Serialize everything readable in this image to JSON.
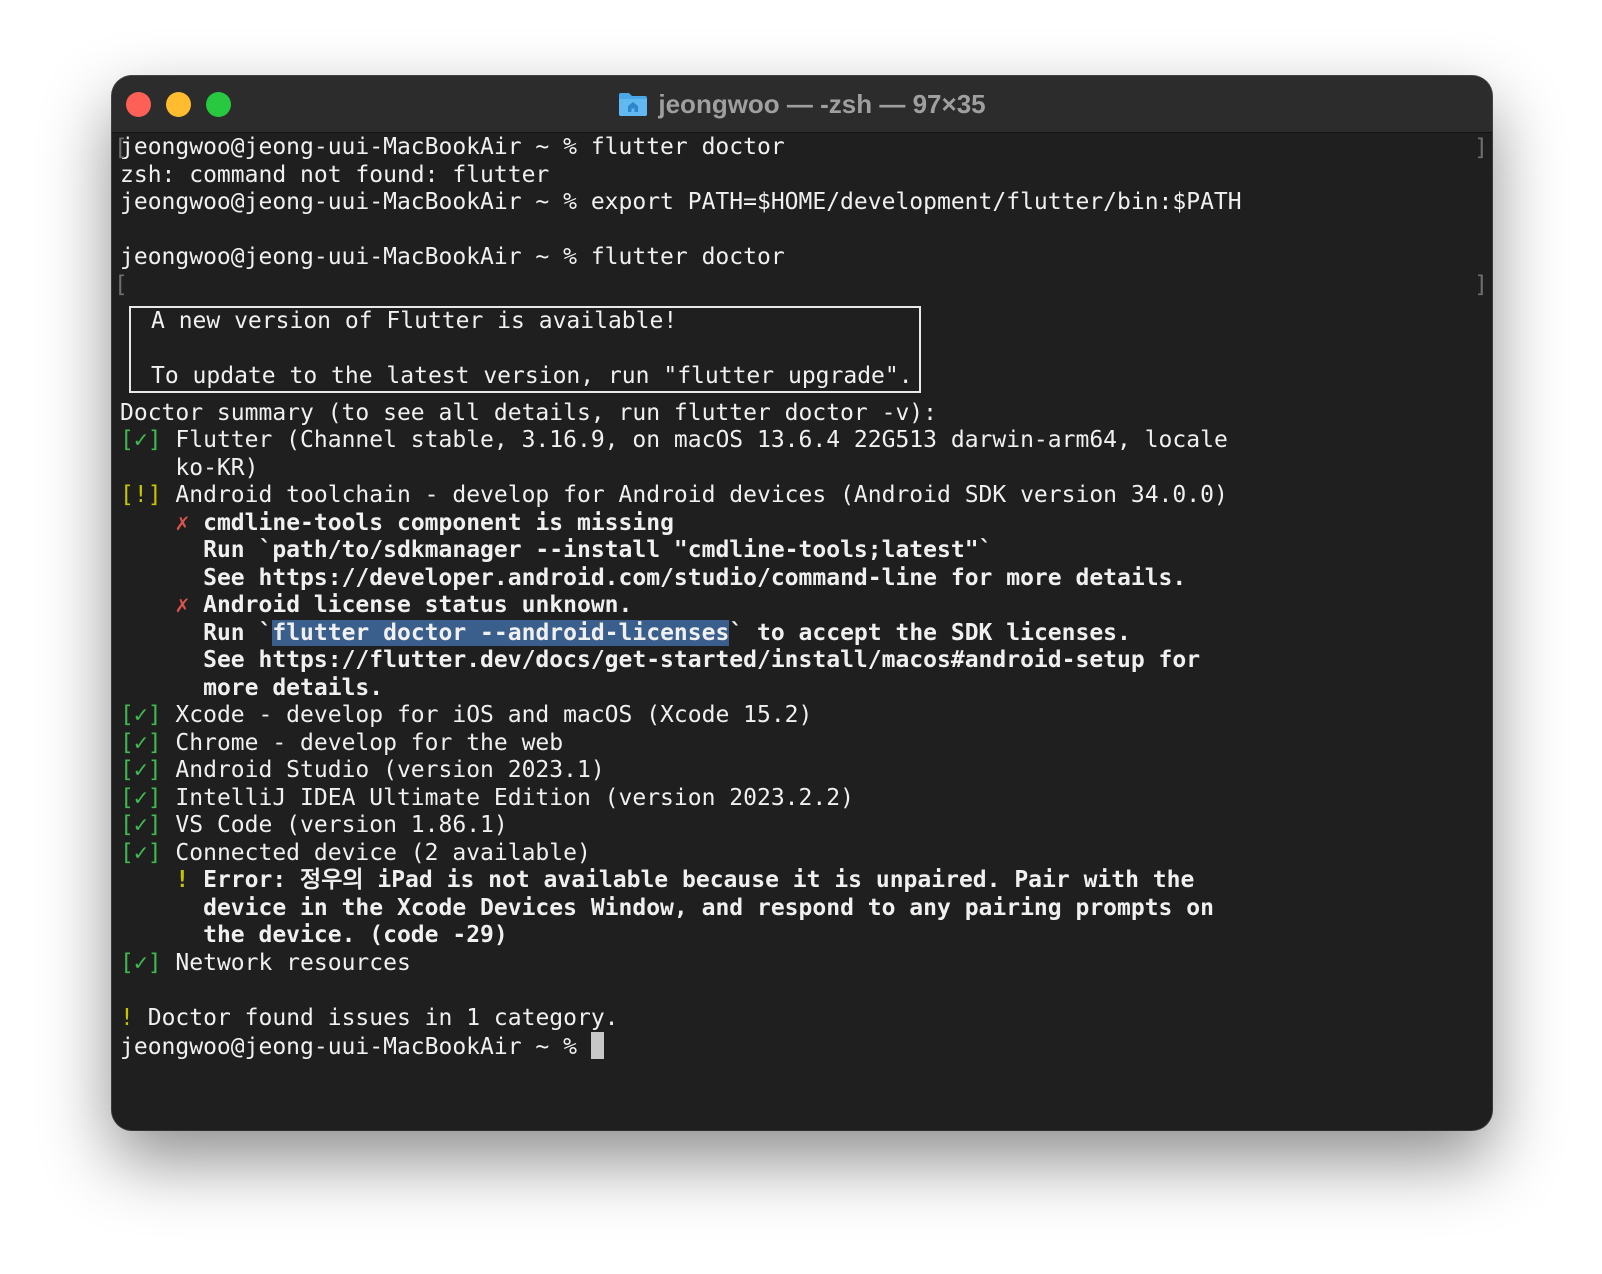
{
  "window": {
    "title": "jeongwoo — -zsh — 97×35"
  },
  "terminal": {
    "prompt": "jeongwoo@jeong-uui-MacBookAir ~ % ",
    "cmd1": "flutter doctor",
    "out1": "zsh: command not found: flutter",
    "cmd2": "export PATH=$HOME/development/flutter/bin:$PATH",
    "cmd3": "flutter doctor",
    "banner_line1": "A new version of Flutter is available!",
    "banner_line2": "To update to the latest version, run \"flutter upgrade\".",
    "summary": "Doctor summary (to see all details, run flutter doctor -v):",
    "check_ok": "[✓]",
    "check_warn": "[!]",
    "x_mark": "✗",
    "bang": "!",
    "flutter_line1": "Flutter (Channel stable, 3.16.9, on macOS 13.6.4 22G513 darwin-arm64, locale",
    "flutter_line2": "ko-KR)",
    "android_line": "Android toolchain - develop for Android devices (Android SDK version 34.0.0)",
    "cmdline_missing": "cmdline-tools component is missing",
    "cmdline_run": "Run `path/to/sdkmanager --install \"cmdline-tools;latest\"`",
    "cmdline_see": "See https://developer.android.com/studio/command-line for more details.",
    "license_unknown": "Android license status unknown.",
    "license_run_pre": "Run `",
    "license_run_sel": "flutter doctor --android-licenses",
    "license_run_post": "` to accept the SDK licenses.",
    "license_see1": "See https://flutter.dev/docs/get-started/install/macos#android-setup for",
    "license_see2": "more details.",
    "xcode": "Xcode - develop for iOS and macOS (Xcode 15.2)",
    "chrome": "Chrome - develop for the web",
    "studio": "Android Studio (version 2023.1)",
    "intellij": "IntelliJ IDEA Ultimate Edition (version 2023.2.2)",
    "vscode": "VS Code (version 1.86.1)",
    "connected": "Connected device (2 available)",
    "error_line1": "Error: 정우의 iPad is not available because it is unpaired. Pair with the",
    "error_line2": "device in the Xcode Devices Window, and respond to any pairing prompts on",
    "error_line3": "the device. (code -29)",
    "network": "Network resources",
    "found_issues": "Doctor found issues in 1 category.",
    "final_prompt": "jeongwoo@jeong-uui-MacBookAir ~ % "
  },
  "colors": {
    "ok": "#3fb950",
    "warn": "#c7c400",
    "error": "#d9534f",
    "selection": "#3b5f8c"
  }
}
